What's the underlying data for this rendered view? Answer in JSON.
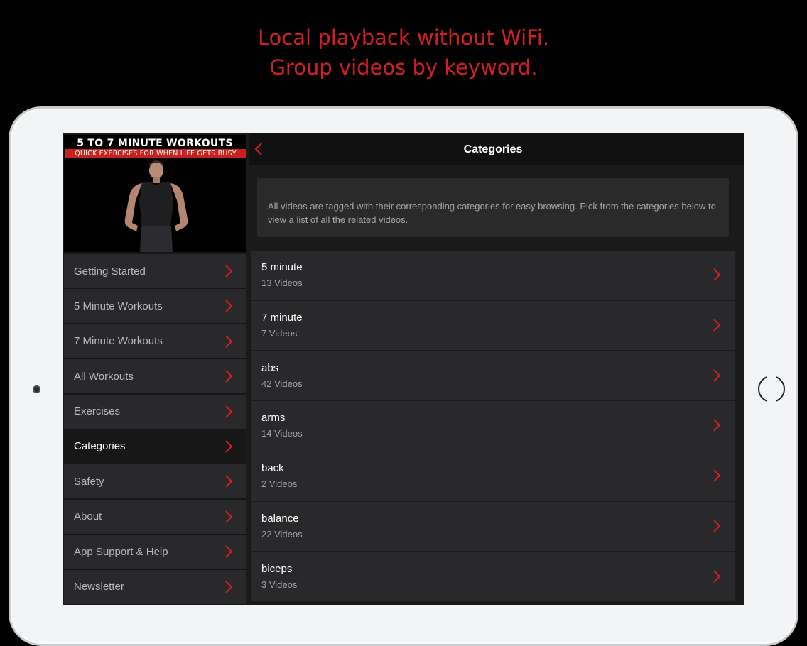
{
  "headline": [
    "Local playback without WiFi.",
    "Group videos by keyword."
  ],
  "colors": {
    "accent": "#d31f22",
    "background": "#000000",
    "panel": "#29292b"
  },
  "sidebar": {
    "hero_title": "5 TO 7 MINUTE WORKOUTS",
    "hero_subtitle": "QUICK EXERCISES FOR WHEN LIFE GETS BUSY",
    "items": [
      {
        "label": "Getting Started"
      },
      {
        "label": "5 Minute Workouts"
      },
      {
        "label": "7 Minute Workouts"
      },
      {
        "label": "All Workouts"
      },
      {
        "label": "Exercises"
      },
      {
        "label": "Categories",
        "active": true
      },
      {
        "label": "Safety"
      },
      {
        "label": "About"
      },
      {
        "label": "App Support & Help"
      },
      {
        "label": "Newsletter"
      }
    ]
  },
  "topbar": {
    "title": "Categories",
    "back_icon": "chevron-left-icon"
  },
  "intro": "All videos are tagged with their corresponding categories for easy browsing. Pick from the categories below to view a list of all the related videos.",
  "categories": [
    {
      "name": "5 minute",
      "count": "13 Videos"
    },
    {
      "name": "7 minute",
      "count": "7 Videos"
    },
    {
      "name": "abs",
      "count": "42 Videos"
    },
    {
      "name": "arms",
      "count": "14 Videos"
    },
    {
      "name": "back",
      "count": "2 Videos"
    },
    {
      "name": "balance",
      "count": "22 Videos"
    },
    {
      "name": "biceps",
      "count": "3 Videos"
    }
  ]
}
